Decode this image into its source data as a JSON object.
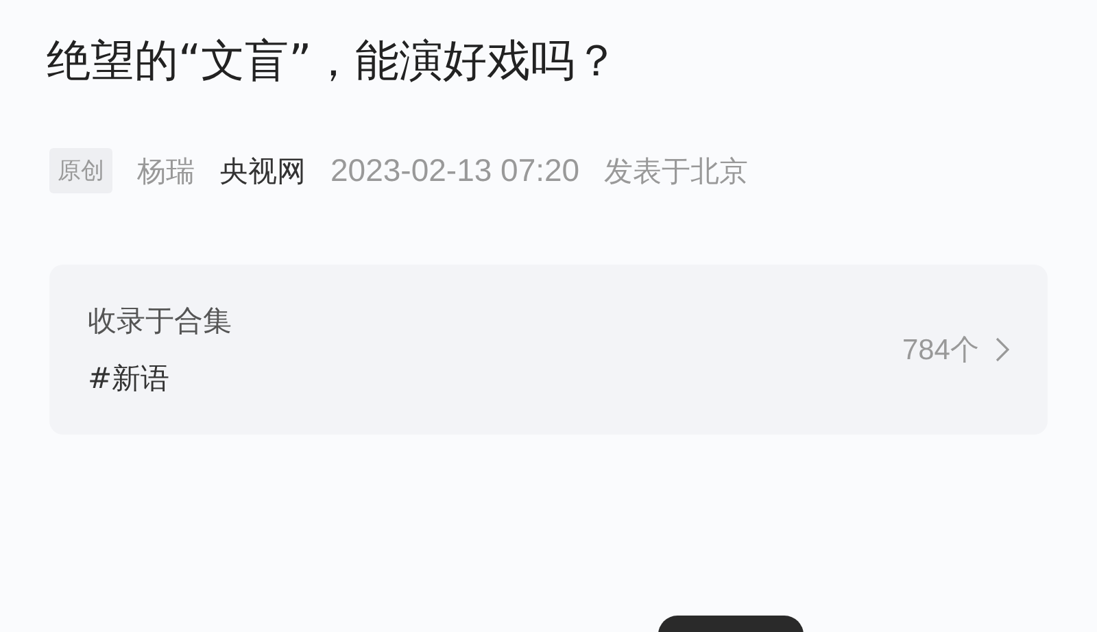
{
  "article": {
    "title": "绝望的“文盲”，能演好戏吗？",
    "meta": {
      "badge": "原创",
      "author": "杨瑞",
      "source": "央视网",
      "time": "2023-02-13 07:20",
      "location": "发表于北京"
    }
  },
  "collection": {
    "label": "收录于合集",
    "tag": "#新语",
    "count": "784个"
  }
}
